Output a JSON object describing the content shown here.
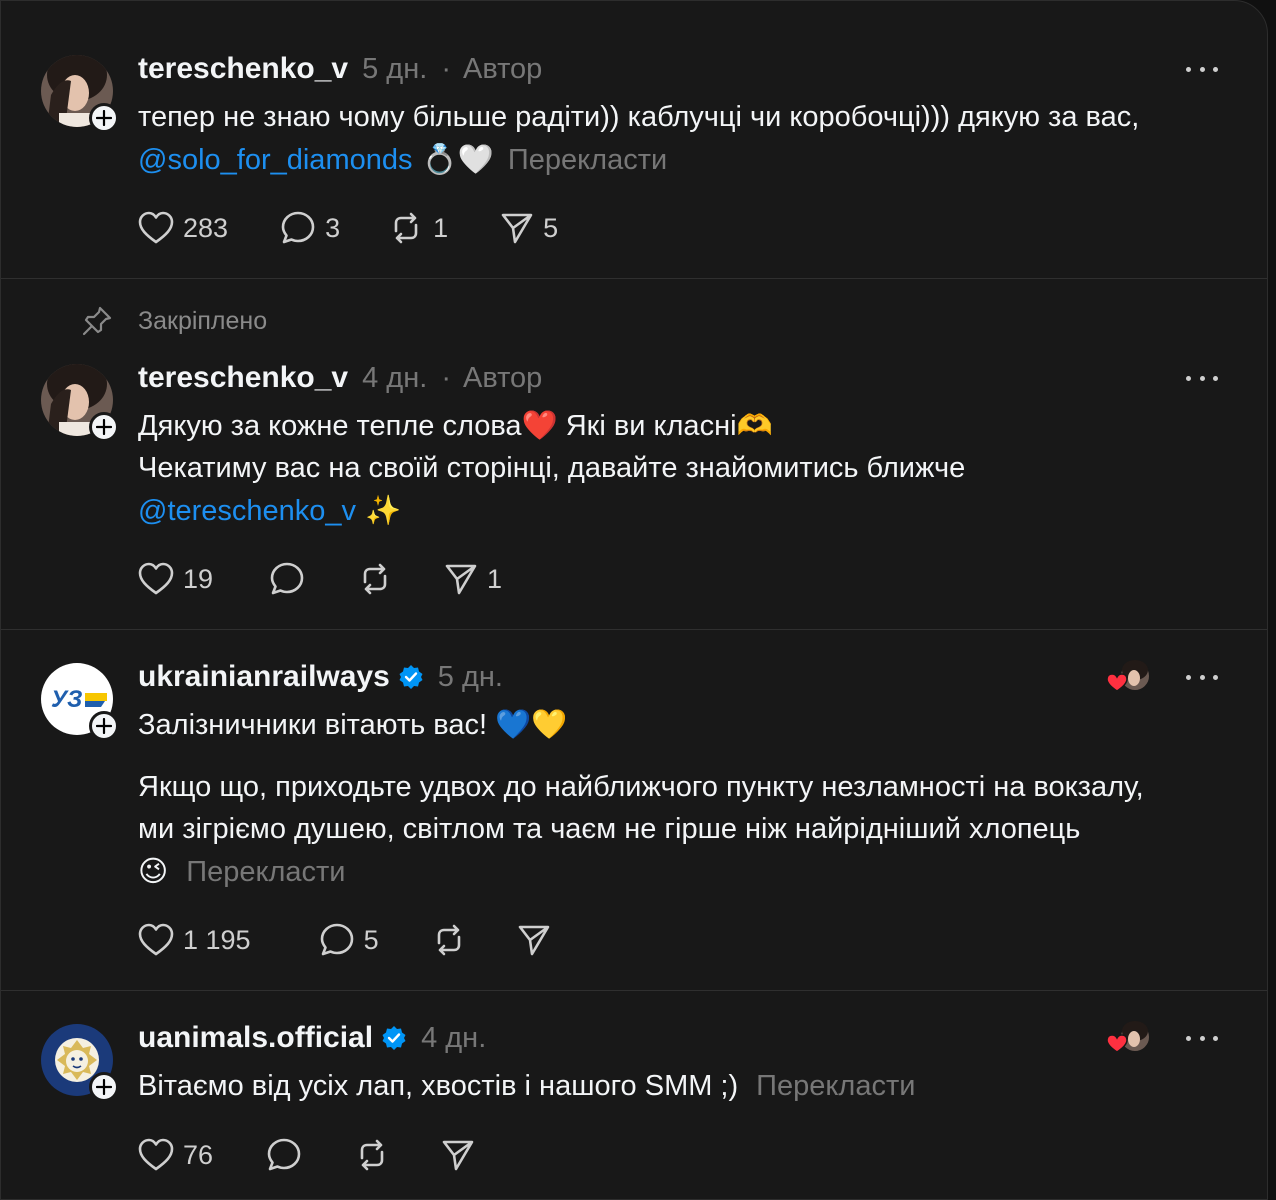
{
  "posts": [
    {
      "username": "tereschenko_v",
      "time": "5 дн.",
      "author_tag": "Автор",
      "lines": [
        "тепер не знаю чому більше радіти)) каблучці чи коробочці))) дякую за вас,"
      ],
      "mention": "@solo_for_diamonds",
      "mention_suffix": " 💍🤍",
      "translate": "Перекласти",
      "likes": "283",
      "replies": "3",
      "reposts": "1",
      "shares": "5"
    },
    {
      "pinned_label": "Закріплено",
      "username": "tereschenko_v",
      "time": "4 дн.",
      "author_tag": "Автор",
      "lines": [
        "Дякую за кожне тепле слова❤️ Які ви класні🫶",
        "Чекатиму вас на своїй сторінці, давайте знайомитись ближче"
      ],
      "mention": "@tereschenko_v",
      "mention_suffix": " ✨",
      "likes": "19",
      "shares": "1"
    },
    {
      "username": "ukrainianrailways",
      "time": "5 дн.",
      "avatar_text": "УЗ",
      "lines": [
        "Залізничники вітають вас! 💙💛",
        "Якщо що, приходьте удвох до найближчого пункту незламності на вокзалу,",
        "ми зігріємо душею, світлом та чаєм не гірше ніж найрідніший хлопець",
        "😉"
      ],
      "translate": "Перекласти",
      "likes": "1 195",
      "replies": "5"
    },
    {
      "username": "uanimals.official",
      "time": "4 дн.",
      "lines": [
        "Вітаємо від усіх лап, хвостів і нашого SMM ;)"
      ],
      "translate": "Перекласти",
      "likes": "76"
    }
  ],
  "colors": {
    "background": "#181818",
    "text": "#f3f5f7",
    "muted": "#777777",
    "mention": "#1d8ff0",
    "verified": "#0095f6",
    "heart": "#ff3040"
  },
  "icons": [
    "heart-icon",
    "reply-icon",
    "repost-icon",
    "share-icon",
    "more-icon",
    "verified-icon",
    "pin-icon",
    "follow-plus-icon"
  ]
}
